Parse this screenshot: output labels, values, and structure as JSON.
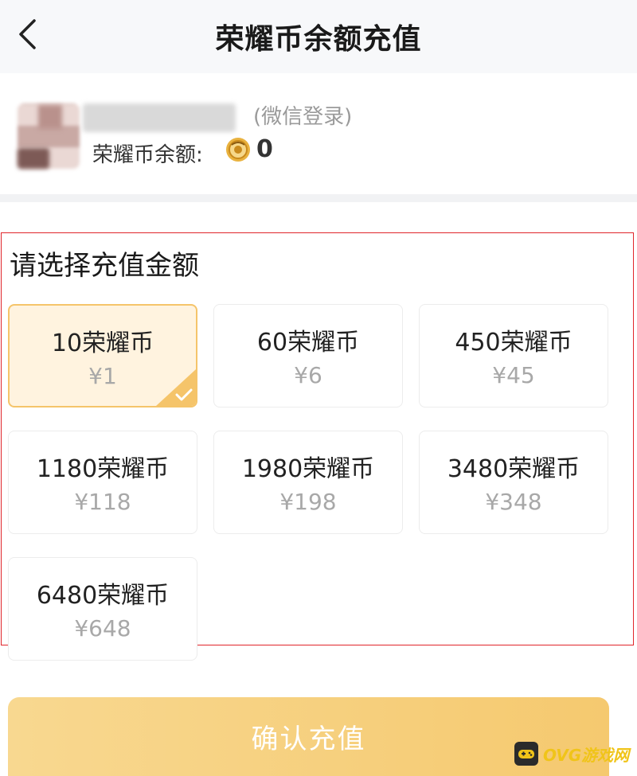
{
  "header": {
    "title": "荣耀币余额充值"
  },
  "user": {
    "login_type": "(微信登录)",
    "balance_label": "荣耀币余额:",
    "balance_value": "0"
  },
  "section": {
    "title": "请选择充值金额"
  },
  "options": [
    {
      "coins": "10荣耀币",
      "price": "¥1",
      "selected": true
    },
    {
      "coins": "60荣耀币",
      "price": "¥6"
    },
    {
      "coins": "450荣耀币",
      "price": "¥45"
    },
    {
      "coins": "1180荣耀币",
      "price": "¥118"
    },
    {
      "coins": "1980荣耀币",
      "price": "¥198"
    },
    {
      "coins": "3480荣耀币",
      "price": "¥348"
    },
    {
      "coins": "6480荣耀币",
      "price": "¥648"
    }
  ],
  "confirm": {
    "label": "确认充值"
  },
  "watermark": {
    "text": "OVG游戏网"
  },
  "colors": {
    "accent": "#f5c46a",
    "selected_bg": "#fff3df",
    "highlight_border": "#e0252a"
  }
}
